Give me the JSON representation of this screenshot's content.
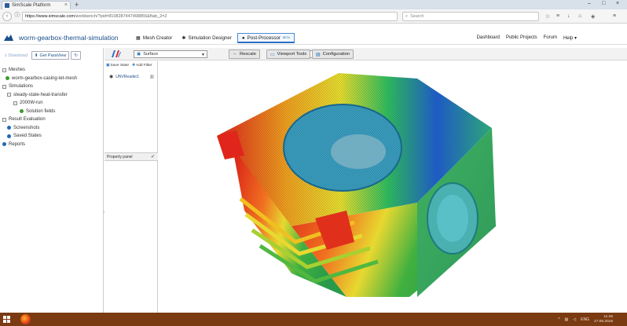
{
  "browser": {
    "tab_title": "SimScale Platform",
    "url_host": "https://www.simscale.com",
    "url_path": "/workbench/?pid=8108287447498855&ftab_2=2",
    "search_placeholder": "Search",
    "accent": "#1b6fb8"
  },
  "header": {
    "project_title": "worm-gearbox-thermal-simulation",
    "tabs": [
      {
        "label": "Mesh Creator",
        "icon": "grid-icon"
      },
      {
        "label": "Simulation Designer",
        "icon": "gears-icon"
      },
      {
        "label": "Post-Processor",
        "badge": "BETA",
        "icon": "circle-icon"
      }
    ],
    "nav": [
      "Dashboard",
      "Public Projects",
      "Forum",
      "Help ▾"
    ]
  },
  "left": {
    "download_label": "Download",
    "get_paraview_label": "Get ParaView",
    "tree": {
      "meshes": "Meshes",
      "mesh_item": "worm-gearbox-casing-tet-mesh",
      "simulations": "Simulations",
      "sim_item": "steady-state-heat-transfer",
      "run_item": "2000W-run",
      "solution_fields": "Solution fields",
      "result_eval": "Result Evaluation",
      "screenshots": "Screenshots",
      "saved_states": "Saved States",
      "reports": "Reports"
    }
  },
  "toolbar": {
    "representation": "Surface",
    "frame": "0",
    "rescale_label": "Rescale",
    "viewport_tools_label": "Viewport Tools",
    "configuration_label": "Configuration"
  },
  "pipeline": {
    "save_state_label": "Save State",
    "add_filter_label": "Add Filter",
    "item_label": "UNVReader1",
    "property_panel_label": "Property panel"
  },
  "taskbar": {
    "language": "ENG",
    "time": "11:26",
    "date": "17.05.2016"
  }
}
